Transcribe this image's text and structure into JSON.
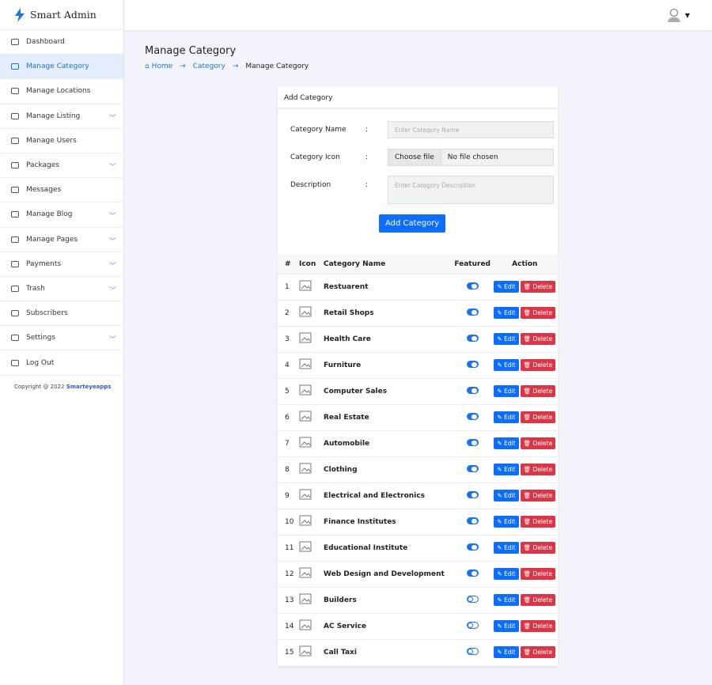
{
  "brand": "Smart Admin",
  "sidebar": {
    "items": [
      {
        "label": "Dashboard",
        "icon": "gauge-icon",
        "chev": false
      },
      {
        "label": "Manage Category",
        "icon": "category-icon",
        "chev": false,
        "active": true
      },
      {
        "label": "Manage Locations",
        "icon": "location-pin-icon",
        "chev": false
      },
      {
        "label": "Manage Listing",
        "icon": "briefcase-icon",
        "chev": true
      },
      {
        "label": "Manage Users",
        "icon": "users-icon",
        "chev": false
      },
      {
        "label": "Packages",
        "icon": "briefcase-icon",
        "chev": true
      },
      {
        "label": "Messages",
        "icon": "message-icon",
        "chev": false
      },
      {
        "label": "Manage Blog",
        "icon": "blog-icon",
        "chev": true
      },
      {
        "label": "Manage Pages",
        "icon": "page-icon",
        "chev": true
      },
      {
        "label": "Payments",
        "icon": "arrows-icon",
        "chev": true
      },
      {
        "label": "Trash",
        "icon": "trash-icon",
        "chev": true
      },
      {
        "label": "Subscribers",
        "icon": "users-icon",
        "chev": false
      },
      {
        "label": "Settings",
        "icon": "gear-icon",
        "chev": true
      },
      {
        "label": "Log Out",
        "icon": "logout-icon",
        "chev": false
      }
    ],
    "copyright": "Copyright @ 2022",
    "copyright_link": "Smarteyeapps"
  },
  "page": {
    "title": "Manage Category",
    "breadcrumb": [
      "Home",
      "Category",
      "Manage Category"
    ]
  },
  "form": {
    "title": "Add Category",
    "name_label": "Category Name",
    "name_placeholder": "Enter Category Name",
    "icon_label": "Category Icon",
    "choose_file": "Choose file",
    "no_file": "No file chosen",
    "desc_label": "Description",
    "desc_placeholder": "Enter Category Description",
    "colon": ":",
    "submit": "Add Category"
  },
  "table": {
    "headers": [
      "#",
      "Icon",
      "Category Name",
      "Featured",
      "Action"
    ],
    "edit": "Edit",
    "delete": "Delete",
    "rows": [
      {
        "n": "1",
        "name": "Restuarent",
        "featured": true
      },
      {
        "n": "2",
        "name": "Retail Shops",
        "featured": true
      },
      {
        "n": "3",
        "name": "Health Care",
        "featured": true
      },
      {
        "n": "4",
        "name": "Furniture",
        "featured": true
      },
      {
        "n": "5",
        "name": "Computer Sales",
        "featured": true
      },
      {
        "n": "6",
        "name": "Real Estate",
        "featured": true
      },
      {
        "n": "7",
        "name": "Automobile",
        "featured": true
      },
      {
        "n": "8",
        "name": "Clothing",
        "featured": true
      },
      {
        "n": "9",
        "name": "Electrical and Electronics",
        "featured": true
      },
      {
        "n": "10",
        "name": "Finance Institutes",
        "featured": true
      },
      {
        "n": "11",
        "name": "Educational Institute",
        "featured": true
      },
      {
        "n": "12",
        "name": "Web Design and Development",
        "featured": true
      },
      {
        "n": "13",
        "name": "Builders",
        "featured": false
      },
      {
        "n": "14",
        "name": "AC Service",
        "featured": false
      },
      {
        "n": "15",
        "name": "Call Taxi",
        "featured": false
      }
    ]
  }
}
